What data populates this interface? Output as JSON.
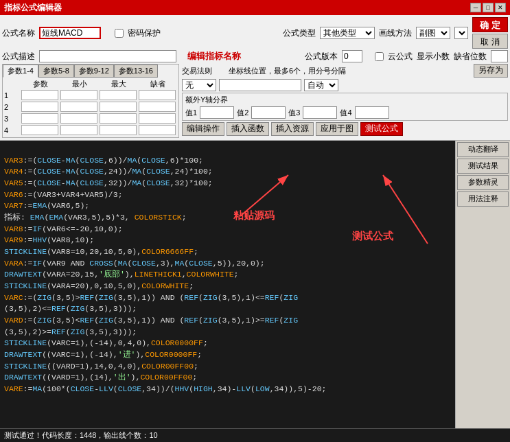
{
  "window": {
    "title": "指标公式编辑器",
    "min_label": "─",
    "max_label": "□",
    "close_label": "✕"
  },
  "form": {
    "formula_name_label": "公式名称",
    "formula_name_value": "短线MACD",
    "password_label": "密码保护",
    "formula_desc_label": "公式描述",
    "formula_desc_value": "",
    "params_tab1": "参数1-4",
    "params_tab2": "参数5-8",
    "params_tab3": "参数9-12",
    "params_tab4": "参数13-16",
    "param_headers": [
      "参数",
      "最小",
      "最大",
      "缺省"
    ],
    "param_rows": [
      "1",
      "2",
      "3",
      "4"
    ],
    "formula_type_label": "公式类型",
    "formula_type_value": "其他类型",
    "draw_method_label": "画线方法",
    "draw_method_value": "副图",
    "formula_version_label": "公式版本",
    "formula_version_value": "0",
    "cloud_formula_label": "云公式",
    "show_small_label": "显示小数",
    "default_digits_label": "缺省位数",
    "trade_rule_label": "交易法则",
    "coord_label": "坐标线位置，最多6个，用分号分隔",
    "coord_value": "",
    "trade_value": "无",
    "auto_label": "自动",
    "save_as_label": "另存为",
    "axis_label": "额外Y轴分界",
    "axis_val1_label": "值1",
    "axis_val1": "",
    "axis_val2_label": "值2",
    "axis_val2": "",
    "axis_val3_label": "值3",
    "axis_val3": "",
    "axis_val4_label": "值4",
    "axis_val4": "",
    "edit_op_label": "编辑操作",
    "insert_func_label": "插入函数",
    "insert_resource_label": "插入资源",
    "apply_chart_label": "应用于图",
    "test_formula_label": "测试公式",
    "confirm_label": "确 定",
    "cancel_label": "取 消"
  },
  "code": {
    "lines": [
      "VAR3:=(CLOSE-MA(CLOSE,6))/MA(CLOSE,6)*100;",
      "VAR4:=(CLOSE-MA(CLOSE,24))/MA(CLOSE,24)*100;",
      "VAR5:=(CLOSE-MA(CLOSE,32))/MA(CLOSE,32)*100;",
      "VAR6:=(VAR3+VAR4+VAR5)/3;",
      "VAR7:=EMA(VAR6,5);",
      "指标: EMA(EMA(VAR3,5),5)*3, COLORSTICK;",
      "VAR8:=IF(VAR6<=-20,10,0);",
      "VAR9:=HHV(VAR8,10);",
      "STICKLINE(VAR8=10,20,10,5,0),COLOR6666FF;",
      "VARA:=IF(VAR9 AND CROSS(MA(CLOSE,3),MA(CLOSE,5)),20,0);",
      "DRAWTEXT(VARA=20,15,'底部'),LINETHICK1,COLORWHITE;",
      "STICKLINE(VARA=20),0,10,5,0),COLORWHITE;",
      "VARC:=(ZIG(3,5)>REF(ZIG(3,5),1)) AND (REF(ZIG(3,5),1)<=REF(ZIG",
      "(3,5),2)<=REF(ZIG(3,5),3));",
      "VARD:=(ZIG(3,5)<REF(ZIG(3,5),1)) AND (REF(ZIG(3,5),1)>=REF(ZIG",
      "(3,5),2)>=REF(ZIG(3,5),3));",
      "STICKLINE(VARC=1),(-14),0,4,0),COLOR0000FF;",
      "DRAWTEXT((VARC=1),(-14),'进'),COLOR0000FF;",
      "STICKLINE((VARD=1),14,0,4,0),COLOR00FF00;",
      "DRAWTEXT((VARD=1),(14),'出'),COLOR00FF00;",
      "VARE:=MA(100*(CLOSE-LLV(CLOSE,34))/(HHV(HIGH,34)-LLV(LOW,34)),5)-20;"
    ]
  },
  "status": {
    "text": "测试通过！代码长度：1448，输出线个数：10"
  },
  "annotations": {
    "edit_name": "编辑指标名称",
    "paste_code": "粘贴源码",
    "test_formula": "测试公式"
  },
  "side_panel": {
    "buttons": [
      "动态翻译",
      "测试结果",
      "参数精灵",
      "用法注释"
    ]
  }
}
